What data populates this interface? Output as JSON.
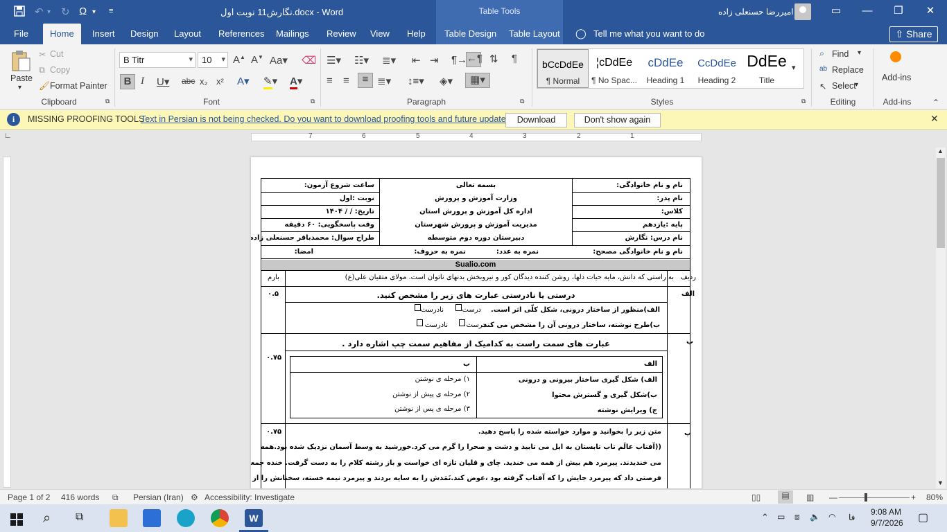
{
  "titlebar": {
    "doc_title": "نگارش11 نوبت اول.docx  -  Word",
    "context_label": "Table Tools",
    "user_name": "امیررضا حسنعلی زاده"
  },
  "icons": {
    "save": "save-icon",
    "undo": "undo-icon",
    "redo": "redo-icon",
    "symbol": "omega-icon"
  },
  "tabs": [
    "File",
    "Home",
    "Insert",
    "Design",
    "Layout",
    "References",
    "Mailings",
    "Review",
    "View",
    "Help",
    "Table Design",
    "Table Layout"
  ],
  "tell_me": "Tell me what you want to do",
  "share": "Share",
  "ribbon": {
    "clipboard": {
      "paste": "Paste",
      "cut": "Cut",
      "copy": "Copy",
      "format_painter": "Format Painter",
      "label": "Clipboard"
    },
    "font": {
      "name": "B Titr",
      "size": "10",
      "label": "Font"
    },
    "paragraph": {
      "label": "Paragraph"
    },
    "styles": {
      "items": [
        {
          "sample": "bCcDdEe",
          "name": "¶ Normal"
        },
        {
          "sample": "¦cDdEe",
          "name": "¶ No Spac..."
        },
        {
          "sample": "cDdEe",
          "name": "Heading 1"
        },
        {
          "sample": "CcDdEe",
          "name": "Heading 2"
        },
        {
          "sample": "DdEe",
          "name": "Title"
        }
      ],
      "label": "Styles"
    },
    "editing": {
      "find": "Find",
      "replace": "Replace",
      "select": "Select",
      "label": "Editing"
    },
    "addins": {
      "button": "Add-ins",
      "label": "Add-ins"
    }
  },
  "message_bar": {
    "title": "MISSING PROOFING TOOLS",
    "text": "Text in Persian is not being checked. Do you want to download proofing tools and future updates?",
    "download": "Download",
    "dont_show": "Don't show again"
  },
  "ruler": {
    "numbers": [
      "7",
      "6",
      "5",
      "4",
      "3",
      "2",
      "1"
    ]
  },
  "document": {
    "header": {
      "right": [
        "نام و نام خانوادگی:",
        "نام پدر:",
        "کلاس:",
        "پایه :یازدهم",
        "نام درس: نگارش"
      ],
      "center": [
        "بسمه تعالی",
        "وزارت آموزش و پرورش",
        "اداره کل آموزش و پرورش استان",
        "مدیریت آموزش و پرورش شهرستان",
        "دبیرستان دوره دوم متوسطه"
      ],
      "left": [
        "ساعت شروع آزمون:",
        "نوبت :اول",
        "تاریخ:   /    /   ۱۴۰۴",
        "وقت پاسخگویی: ۶۰ دقیقه",
        "طراح سوال: محمدباقر حسنعلی زاده"
      ],
      "grader": "نام و نام خانوادگی مصحح:",
      "score_num": "نمره به عدد:",
      "score_words": "نمره به حروف:",
      "signature": "امضا:"
    },
    "site": "Sualio.com",
    "col_row": "ردیف",
    "col_barem": "بارم",
    "intro": "به راستی که دانش، مایه حیات دلها، روشن کننده دیدگان کور و نیروبخش بدنهای ناتوان است. مولای متقیان علی(ع)",
    "q_alef": {
      "label": "الف",
      "score": "۰.۵",
      "title": "درستی یا نادرستی عبارت های زیر را مشخص کنید.",
      "items": [
        "الف)منظور از ساختار درونی، شکل کلّی اثر است.",
        "ب)طرح نوشته، ساختار درونی آن را مشخص می کند."
      ],
      "true": "درست",
      "false": "نادرست"
    },
    "q_be": {
      "label": "ب",
      "score": "۰.۷۵",
      "title": "عبارت های سمت راست به کدامیک از مفاهیم سمت چپ اشاره دارد .",
      "col_alef": "الف",
      "col_be": "ب",
      "alef_items": [
        "الف) شکل گیری ساختار بیرونی و درونی",
        "ب)شکل گیری و گسترش محتوا",
        "ج) ویرایش نوشته"
      ],
      "be_items": [
        "۱) مرحله ی نوشتن",
        "۲) مرحله ی پیش از نوشتن",
        "۳) مرحله ی پس از نوشتن"
      ]
    },
    "q_pe": {
      "label": "پ",
      "score": "۰.۷۵",
      "title": "متن زیر را بخوانید و موارد خواسته شده را پاسخ دهید.",
      "lines": [
        "((آفتاب عالَم تاب تابستان به ایل می تابید و دشت و صحرا را گرم می کرد.خورشید به وسط آسمان نزدیک شده بود.همه",
        "می خندیدند. پیرمرد هم بیش از همه می خندید. چای و قلیان تازه ای خواست و باز رشته کلام را به دست گرفت. خنده جمعیت",
        "فرصتی داد که پیرمرد جایش را که آفتاب گرفته بود ،عوض کند.نَمَدش را به سایه بردند و پیرمرد نیمه خسته، سخنانش را از سر"
      ]
    }
  },
  "status": {
    "page": "Page 1 of 2",
    "words": "416 words",
    "language": "Persian (Iran)",
    "accessibility": "Accessibility: Investigate",
    "zoom": "80%"
  },
  "taskbar": {
    "time": "9:08 AM",
    "date": "9/7/2026",
    "lang": "فا"
  }
}
